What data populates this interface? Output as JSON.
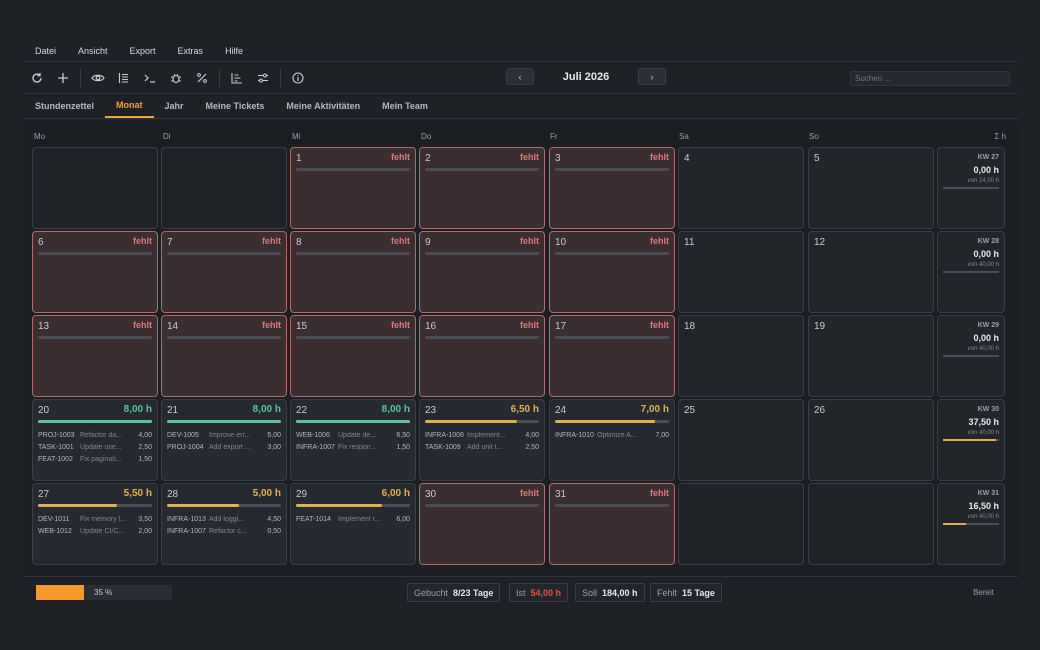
{
  "menu": [
    "Datei",
    "Ansicht",
    "Export",
    "Extras",
    "Hilfe"
  ],
  "toolbar": {
    "icons": [
      "refresh-icon",
      "add-icon",
      "eye-icon",
      "list-icon",
      "terminal-icon",
      "bug-icon",
      "percent-icon",
      "chart-icon",
      "sliders-icon",
      "info-icon"
    ],
    "prev": "‹",
    "next": "›",
    "month_label": "Juli 2026",
    "search_placeholder": "Suchen ..."
  },
  "tabs": [
    {
      "label": "Stundenzettel",
      "active": false
    },
    {
      "label": "Monat",
      "active": true
    },
    {
      "label": "Jahr",
      "active": false
    },
    {
      "label": "Meine Tickets",
      "active": false
    },
    {
      "label": "Meine Aktivitäten",
      "active": false
    },
    {
      "label": "Mein Team",
      "active": false
    }
  ],
  "weekdays": [
    "Mo",
    "Di",
    "Mi",
    "Do",
    "Fr",
    "Sa",
    "So"
  ],
  "week_col_header": "Σ h",
  "colors": {
    "accent": "#f0a040",
    "full": "#5ec29a",
    "partial": "#e0b050",
    "missing": "#d97a7a"
  },
  "weeks": [
    {
      "kw": "KW 27",
      "total": "0,00 h",
      "von": "von 24,00 h",
      "progress": 0,
      "days": [
        {
          "type": "empty"
        },
        {
          "type": "empty"
        },
        {
          "type": "missing",
          "num": "1",
          "status": "fehlt"
        },
        {
          "type": "missing",
          "num": "2",
          "status": "fehlt"
        },
        {
          "type": "missing",
          "num": "3",
          "status": "fehlt"
        },
        {
          "type": "weekend",
          "num": "4"
        },
        {
          "type": "weekend",
          "num": "5"
        }
      ]
    },
    {
      "kw": "KW 28",
      "total": "0,00 h",
      "von": "von 40,00 h",
      "progress": 0,
      "days": [
        {
          "type": "missing",
          "num": "6",
          "status": "fehlt"
        },
        {
          "type": "missing",
          "num": "7",
          "status": "fehlt"
        },
        {
          "type": "missing",
          "num": "8",
          "status": "fehlt"
        },
        {
          "type": "missing",
          "num": "9",
          "status": "fehlt"
        },
        {
          "type": "missing",
          "num": "10",
          "status": "fehlt"
        },
        {
          "type": "weekend",
          "num": "11"
        },
        {
          "type": "weekend",
          "num": "12"
        }
      ]
    },
    {
      "kw": "KW 29",
      "total": "0,00 h",
      "von": "von 40,00 h",
      "progress": 0,
      "days": [
        {
          "type": "missing",
          "num": "13",
          "status": "fehlt"
        },
        {
          "type": "missing",
          "num": "14",
          "status": "fehlt"
        },
        {
          "type": "missing",
          "num": "15",
          "status": "fehlt"
        },
        {
          "type": "missing",
          "num": "16",
          "status": "fehlt"
        },
        {
          "type": "missing",
          "num": "17",
          "status": "fehlt"
        },
        {
          "type": "weekend",
          "num": "18"
        },
        {
          "type": "weekend",
          "num": "19"
        }
      ]
    },
    {
      "kw": "KW 30",
      "total": "37,50 h",
      "von": "von 40,00 h",
      "progress": 0.94,
      "days": [
        {
          "type": "booked",
          "num": "20",
          "hours": "8,00 h",
          "level": "full",
          "progress": 1.0,
          "entries": [
            [
              "PROJ-1003",
              "Refactor da...",
              "4,00"
            ],
            [
              "TASK-1001",
              "Update use...",
              "2,50"
            ],
            [
              "FEAT-1002",
              "Fix paginati...",
              "1,50"
            ]
          ]
        },
        {
          "type": "booked",
          "num": "21",
          "hours": "8,00 h",
          "level": "full",
          "progress": 1.0,
          "entries": [
            [
              "DEV-1005",
              "Improve err...",
              "5,00"
            ],
            [
              "PROJ-1004",
              "Add export ...",
              "3,00"
            ]
          ]
        },
        {
          "type": "booked",
          "num": "22",
          "hours": "8,00 h",
          "level": "full",
          "progress": 1.0,
          "entries": [
            [
              "WEB-1006",
              "Update de...",
              "6,50"
            ],
            [
              "INFRA-1007",
              "Fix respon...",
              "1,50"
            ]
          ]
        },
        {
          "type": "booked",
          "num": "23",
          "hours": "6,50 h",
          "level": "partial",
          "progress": 0.81,
          "entries": [
            [
              "INFRA-1008",
              "Implement...",
              "4,00"
            ],
            [
              "TASK-1009",
              "Add unit t...",
              "2,50"
            ]
          ]
        },
        {
          "type": "booked",
          "num": "24",
          "hours": "7,00 h",
          "level": "partial",
          "progress": 0.88,
          "entries": [
            [
              "INFRA-1010",
              "Optimize A...",
              "7,00"
            ]
          ]
        },
        {
          "type": "weekend",
          "num": "25"
        },
        {
          "type": "weekend",
          "num": "26"
        }
      ]
    },
    {
      "kw": "KW 31",
      "total": "16,50 h",
      "von": "von 40,00 h",
      "progress": 0.41,
      "days": [
        {
          "type": "booked",
          "num": "27",
          "hours": "5,50 h",
          "level": "partial",
          "progress": 0.69,
          "entries": [
            [
              "DEV-1011",
              "Fix memory l...",
              "3,50"
            ],
            [
              "WEB-1012",
              "Update CI/C...",
              "2,00"
            ]
          ]
        },
        {
          "type": "booked",
          "num": "28",
          "hours": "5,00 h",
          "level": "partial",
          "progress": 0.63,
          "entries": [
            [
              "INFRA-1013",
              "Add loggi...",
              "4,50"
            ],
            [
              "INFRA-1007",
              "Refactor c...",
              "0,50"
            ]
          ]
        },
        {
          "type": "booked",
          "num": "29",
          "hours": "6,00 h",
          "level": "partial",
          "progress": 0.75,
          "entries": [
            [
              "FEAT-1014",
              "Implement r...",
              "6,00"
            ]
          ]
        },
        {
          "type": "missing",
          "num": "30",
          "status": "fehlt"
        },
        {
          "type": "missing",
          "num": "31",
          "status": "fehlt"
        },
        {
          "type": "empty"
        },
        {
          "type": "empty"
        }
      ]
    }
  ],
  "status": {
    "progress_pct": 35,
    "progress_text": "35 %",
    "gebucht_label": "Gebucht",
    "gebucht_value": "8/23 Tage",
    "ist_label": "Ist",
    "ist_value": "54,00 h",
    "soll_label": "Soll",
    "soll_value": "184,00 h",
    "fehlt_label": "Fehlt",
    "fehlt_value": "15 Tage",
    "ready": "Bereit"
  }
}
